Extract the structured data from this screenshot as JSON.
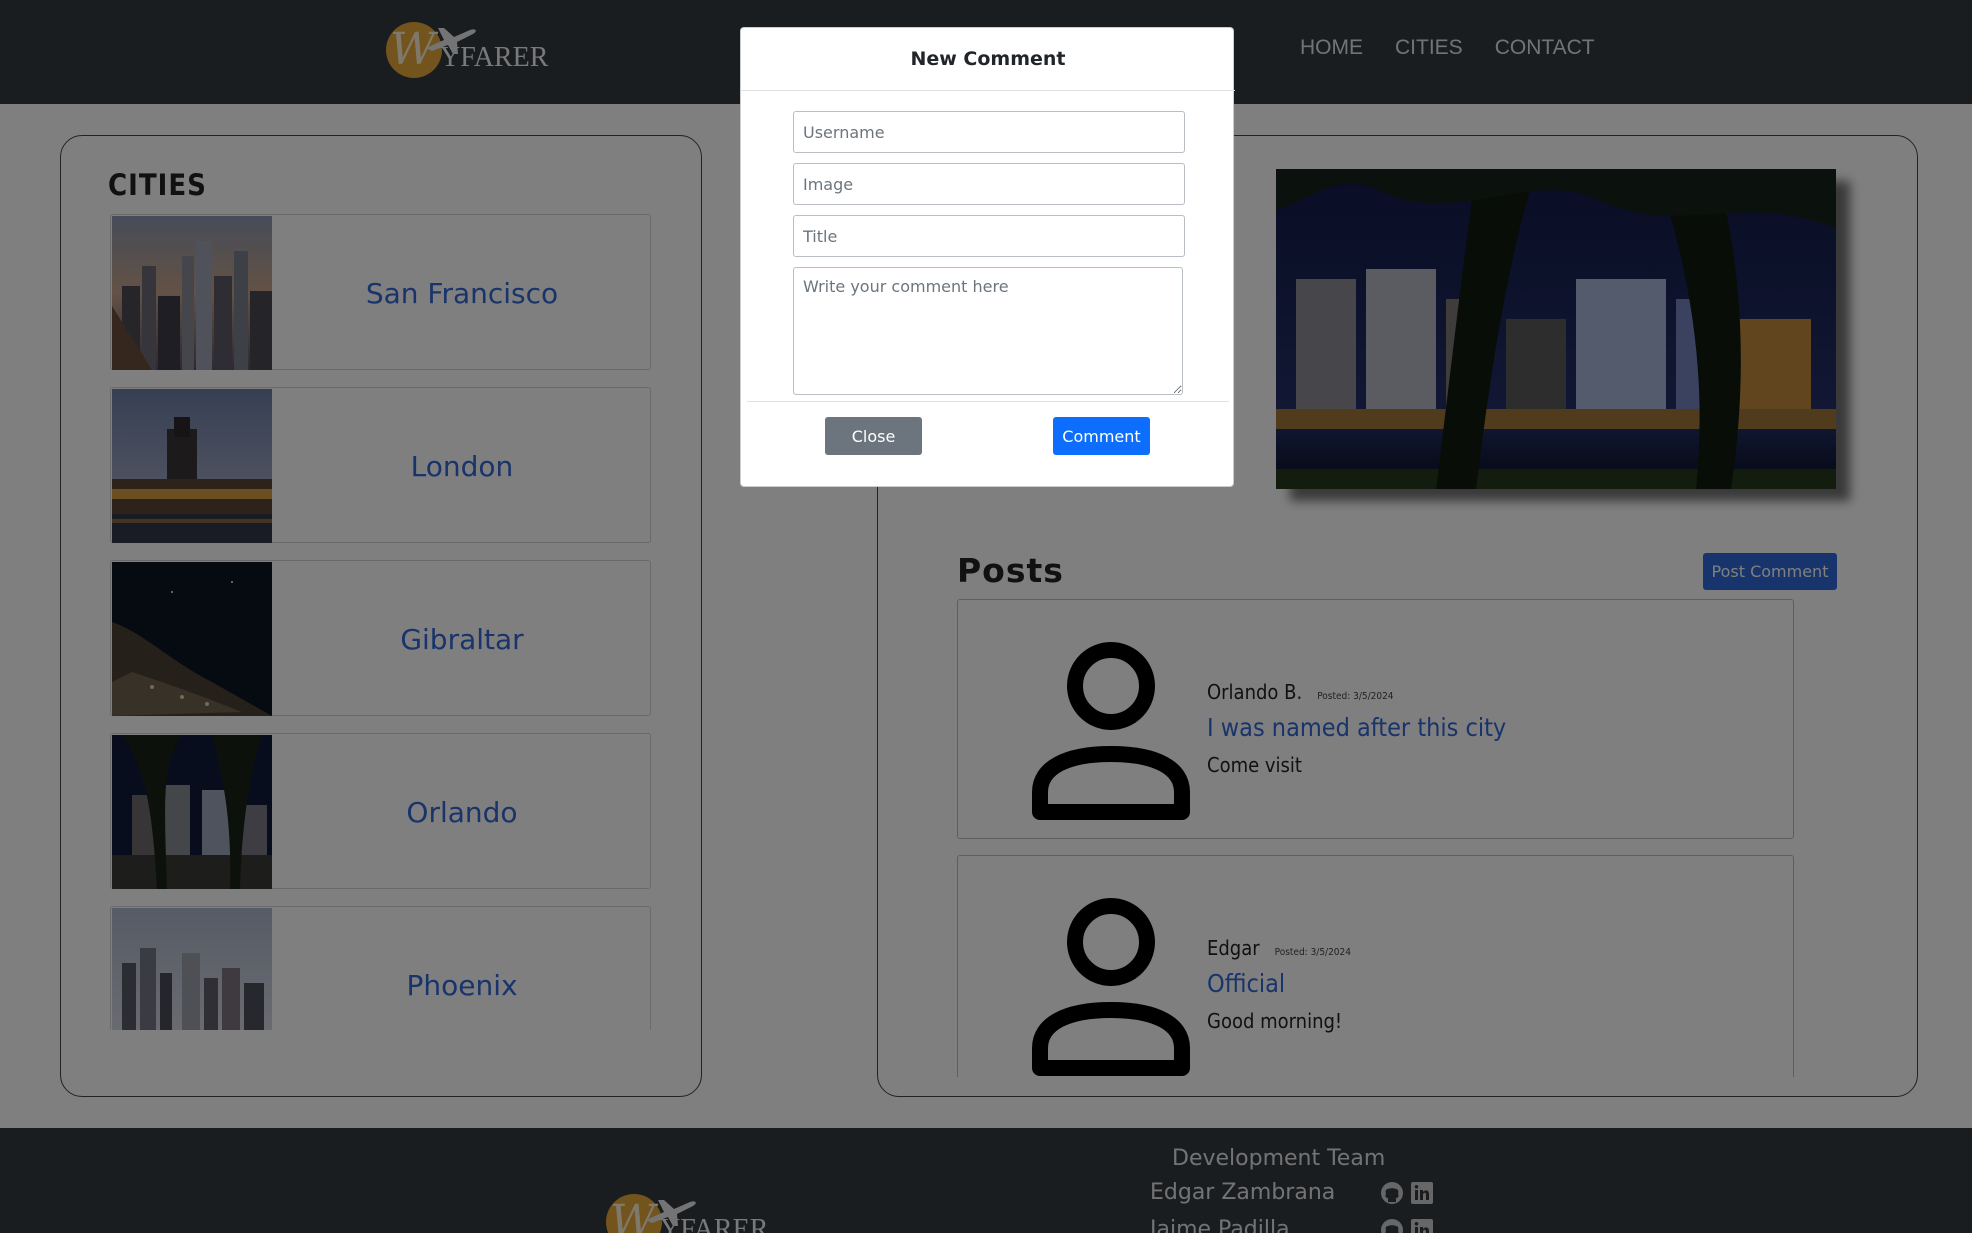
{
  "navbar": {
    "brand_text": "YFARER",
    "brand_initial": "W",
    "links": [
      "HOME",
      "CITIES",
      "CONTACT"
    ]
  },
  "cities": {
    "title": "CITIES",
    "items": [
      {
        "name": "San Francisco",
        "image": "san-francisco-skyline-photo"
      },
      {
        "name": "London",
        "image": "london-parliament-photo"
      },
      {
        "name": "Gibraltar",
        "image": "gibraltar-night-photo"
      },
      {
        "name": "Orlando",
        "image": "orlando-lake-night-photo"
      },
      {
        "name": "Phoenix",
        "image": "phoenix-skyline-photo"
      }
    ]
  },
  "city_detail": {
    "photo": "orlando-lake-eola-night-photo"
  },
  "posts": {
    "title": "Posts",
    "post_comment_label": "Post Comment",
    "items": [
      {
        "user": "Orlando B.",
        "date": "Posted: 3/5/2024",
        "title": "I was named after this city",
        "body": "Come visit"
      },
      {
        "user": "Edgar",
        "date": "Posted: 3/5/2024",
        "title": "Official",
        "body": "Good morning!"
      }
    ]
  },
  "footer": {
    "title": "Development Team",
    "developers": [
      {
        "name": "Edgar Zambrana"
      },
      {
        "name": "Jaime Padilla"
      }
    ],
    "brand_text": "YFARER",
    "brand_initial": "W"
  },
  "modal": {
    "title": "New Comment",
    "username_placeholder": "Username",
    "image_placeholder": "Image",
    "title_placeholder": "Title",
    "comment_placeholder": "Write your comment here",
    "close_label": "Close",
    "comment_label": "Comment"
  },
  "colors": {
    "navbar_bg": "#343a40",
    "link_blue": "#3367d6",
    "primary_button": "#0d6efd",
    "secondary_button": "#6c757d",
    "brand_orange": "#e7a83a"
  }
}
